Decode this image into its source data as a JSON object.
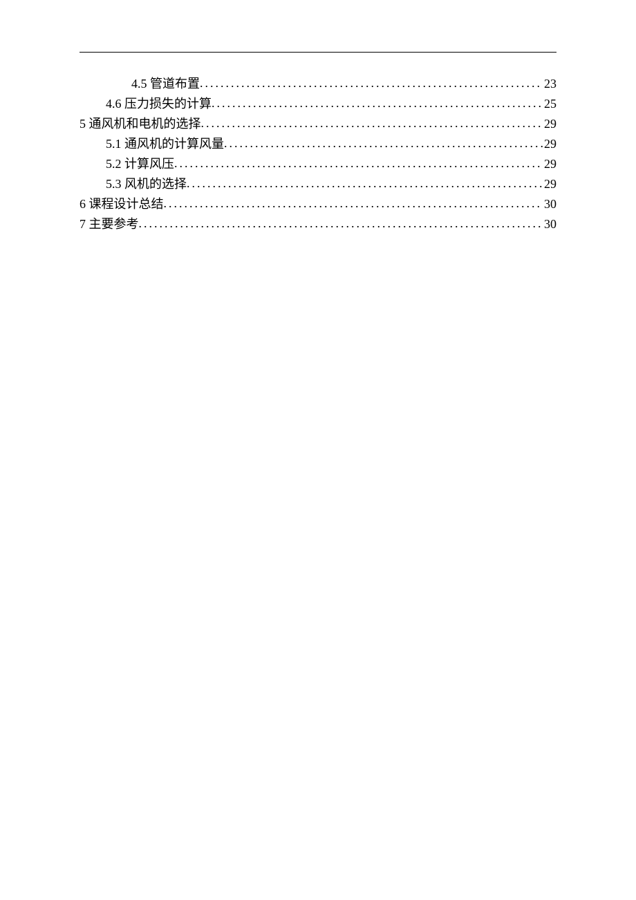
{
  "toc": [
    {
      "indent": 2,
      "label": "4.5 管道布置",
      "page": "23"
    },
    {
      "indent": 1,
      "label": "4.6 压力损失的计算",
      "page": "25"
    },
    {
      "indent": 0,
      "label": "5 通风机和电机的选择",
      "page": "29"
    },
    {
      "indent": 1,
      "label": "5.1 通风机的计算风量",
      "page": "29"
    },
    {
      "indent": 1,
      "label": "5.2 计算风压",
      "page": "29"
    },
    {
      "indent": 1,
      "label": "5.3 风机的选择",
      "page": "29"
    },
    {
      "indent": 0,
      "label": "6 课程设计总结",
      "page": "30"
    },
    {
      "indent": 0,
      "label": "7 主要参考",
      "page": "30"
    }
  ]
}
